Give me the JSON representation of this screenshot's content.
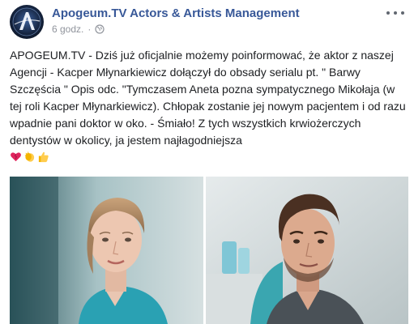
{
  "header": {
    "page_name": "Apogeum.TV Actors & Artists Management",
    "time": "6 godz.",
    "separator": "·",
    "privacy_icon": "globe-icon",
    "more_icon": "more-options-icon",
    "avatar_icon": "apogeum-logo"
  },
  "post": {
    "text": "APOGEUM.TV - Dziś już oficjalnie możemy poinformować, że aktor z naszej Agencji - Kacper Młynarkiewicz dołączył do obsady serialu pt. \" Barwy Szczęścia \" Opis odc. \"Tymczasem Aneta pozna sympatycznego Mikołaja (w tej roli Kacper Młynarkiewicz). Chłopak zostanie jej nowym pacjentem i od razu wpadnie pani doktor w oko. - Śmiało! Z tych wszystkich krwiożerczych dentystów w okolicy, ja jestem najłagodniejsza",
    "emojis": [
      "heart-icon",
      "clapping-hands-icon",
      "thumbs-up-icon"
    ]
  },
  "photos": [
    {
      "subject": "woman-in-dental-clinic"
    },
    {
      "subject": "man-in-dental-chair"
    }
  ],
  "colors": {
    "link": "#385898",
    "meta": "#90949c",
    "text": "#1c1e21"
  }
}
